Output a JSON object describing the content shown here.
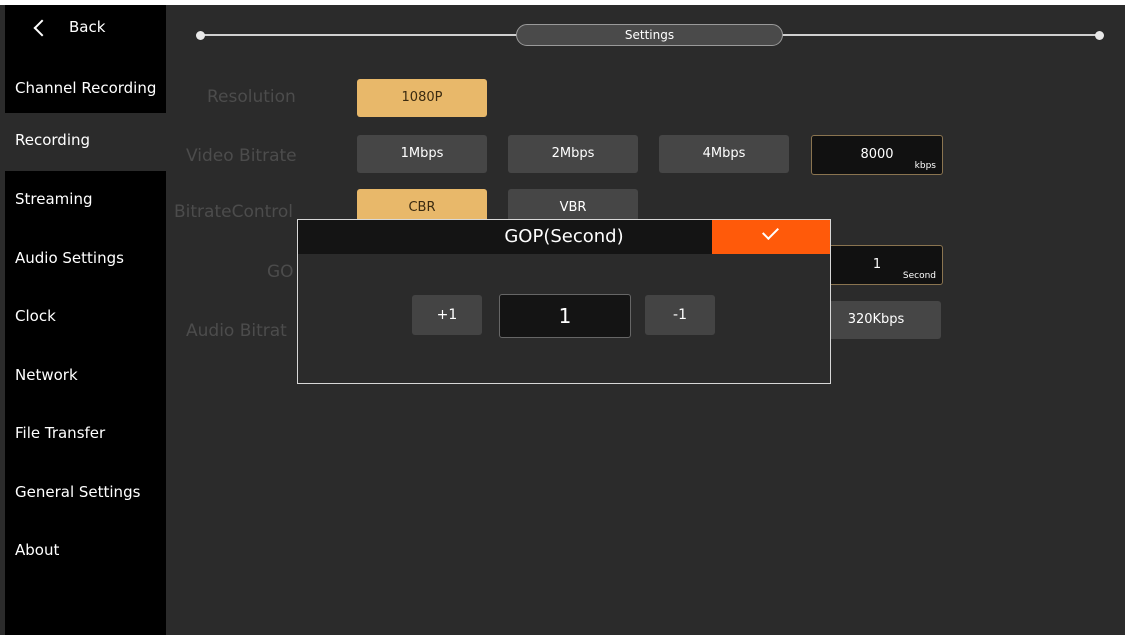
{
  "sidebar": {
    "back_label": "Back",
    "items": [
      {
        "label": "Channel Recording",
        "active": false
      },
      {
        "label": "Recording",
        "active": true
      },
      {
        "label": "Streaming",
        "active": false
      },
      {
        "label": "Audio Settings",
        "active": false
      },
      {
        "label": "Clock",
        "active": false
      },
      {
        "label": "Network",
        "active": false
      },
      {
        "label": "File Transfer",
        "active": false
      },
      {
        "label": "General Settings",
        "active": false
      },
      {
        "label": "About",
        "active": false
      }
    ]
  },
  "header": {
    "title": "Settings"
  },
  "settings": {
    "resolution": {
      "label": "Resolution",
      "options": [
        "1080P"
      ],
      "selected": "1080P"
    },
    "video_bitrate": {
      "label": "Video Bitrate",
      "options": [
        "1Mbps",
        "2Mbps",
        "4Mbps"
      ],
      "custom_value": "8000",
      "custom_unit": "kbps"
    },
    "bitrate_control": {
      "label": "BitrateControl",
      "options": [
        "CBR",
        "VBR"
      ],
      "selected": "CBR"
    },
    "gop": {
      "label": "GO",
      "value": "1",
      "unit": "Second"
    },
    "audio_bitrate": {
      "label": "Audio Bitrat",
      "visible_option": "320Kbps"
    }
  },
  "dialog": {
    "title": "GOP(Second)",
    "increment_label": "+1",
    "value": "1",
    "decrement_label": "-1"
  },
  "colors": {
    "accent_orange": "#ff5a0a",
    "selected_gold": "#e8b86a",
    "sidebar_bg": "#000000",
    "main_bg": "#2b2b2b"
  }
}
